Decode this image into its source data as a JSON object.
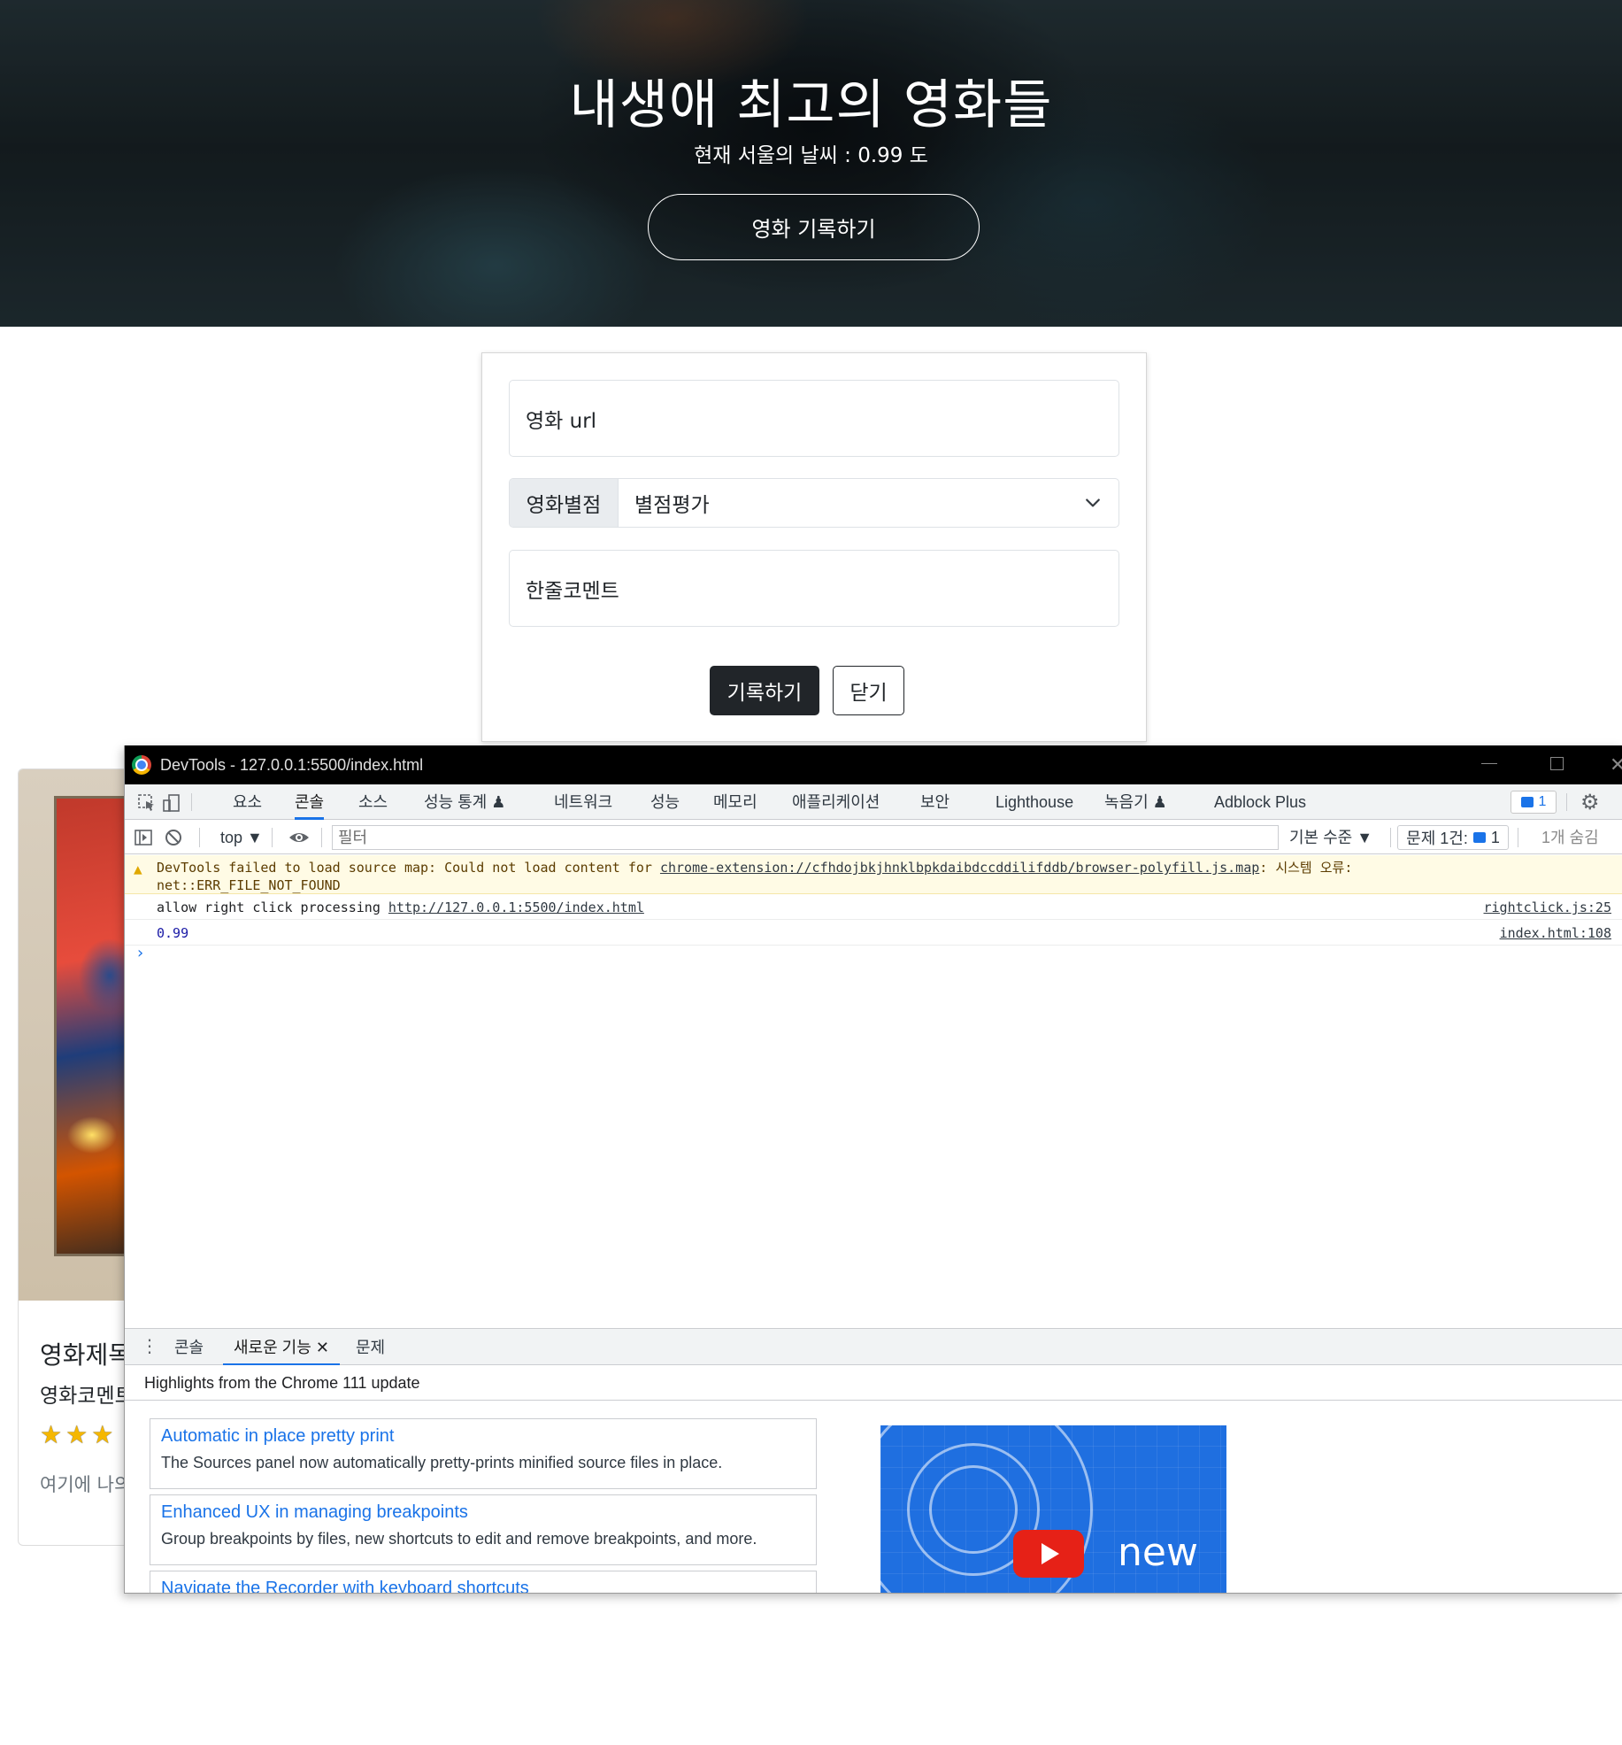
{
  "hero": {
    "title": "내생애 최고의 영화들",
    "weather": "현재 서울의 날씨 : 0.99 도",
    "record_button": "영화 기록하기"
  },
  "form": {
    "url_placeholder": "영화 url",
    "rating_label": "영화별점",
    "rating_selected": "별점평가",
    "comment_placeholder": "한줄코멘트",
    "save_button": "기록하기",
    "close_button": "닫기"
  },
  "movie_card": {
    "title": "영화제목",
    "comment": "영화코멘트",
    "stars": "★★★",
    "description": "여기에 나의"
  },
  "devtools": {
    "window_title": "DevTools - 127.0.0.1:5500/index.html",
    "tabs": [
      "요소",
      "콘솔",
      "소스",
      "성능 통계 ♟",
      "네트워크",
      "성능",
      "메모리",
      "애플리케이션",
      "보안",
      "Lighthouse",
      "녹음기 ♟",
      "Adblock Plus"
    ],
    "active_tab": "콘솔",
    "issue_count": "1",
    "context": "top ▼",
    "filter_placeholder": "필터",
    "level": "기본 수준 ▼",
    "issues_label": "문제 1건:",
    "issues_badge": "1",
    "hidden_count": "1개 숨김",
    "warning": {
      "prefix": "DevTools failed to load source map: Could not load content for ",
      "link": "chrome-extension://cfhdojbkjhnklbpkdaibdccddilifddb/browser-polyfill.js.map",
      "suffix": ": 시스템 오류:",
      "line2": "net::ERR_FILE_NOT_FOUND"
    },
    "logs": [
      {
        "text": "allow right click processing ",
        "link": "http://127.0.0.1:5500/index.html",
        "source": "rightclick.js:25"
      },
      {
        "text": "0.99",
        "source": "index.html:108"
      }
    ],
    "drawer": {
      "tabs": [
        "콘솔",
        "새로운 기능",
        "문제"
      ],
      "active_tab": "새로운 기능",
      "header": "Highlights from the Chrome 111 update",
      "features": [
        {
          "title": "Automatic in place pretty print",
          "desc": "The Sources panel now automatically pretty-prints minified source files in place."
        },
        {
          "title": "Enhanced UX in managing breakpoints",
          "desc": "Group breakpoints by files, new shortcuts to edit and remove breakpoints, and more."
        },
        {
          "title": "Navigate the Recorder with keyboard shortcuts",
          "desc": ""
        }
      ],
      "video_text": "new"
    }
  },
  "colors": {
    "primary_dark": "#212529",
    "devtools_link": "#1a73e8",
    "warning_bg": "#fffbe5",
    "video_bg": "#1f6fe0"
  }
}
